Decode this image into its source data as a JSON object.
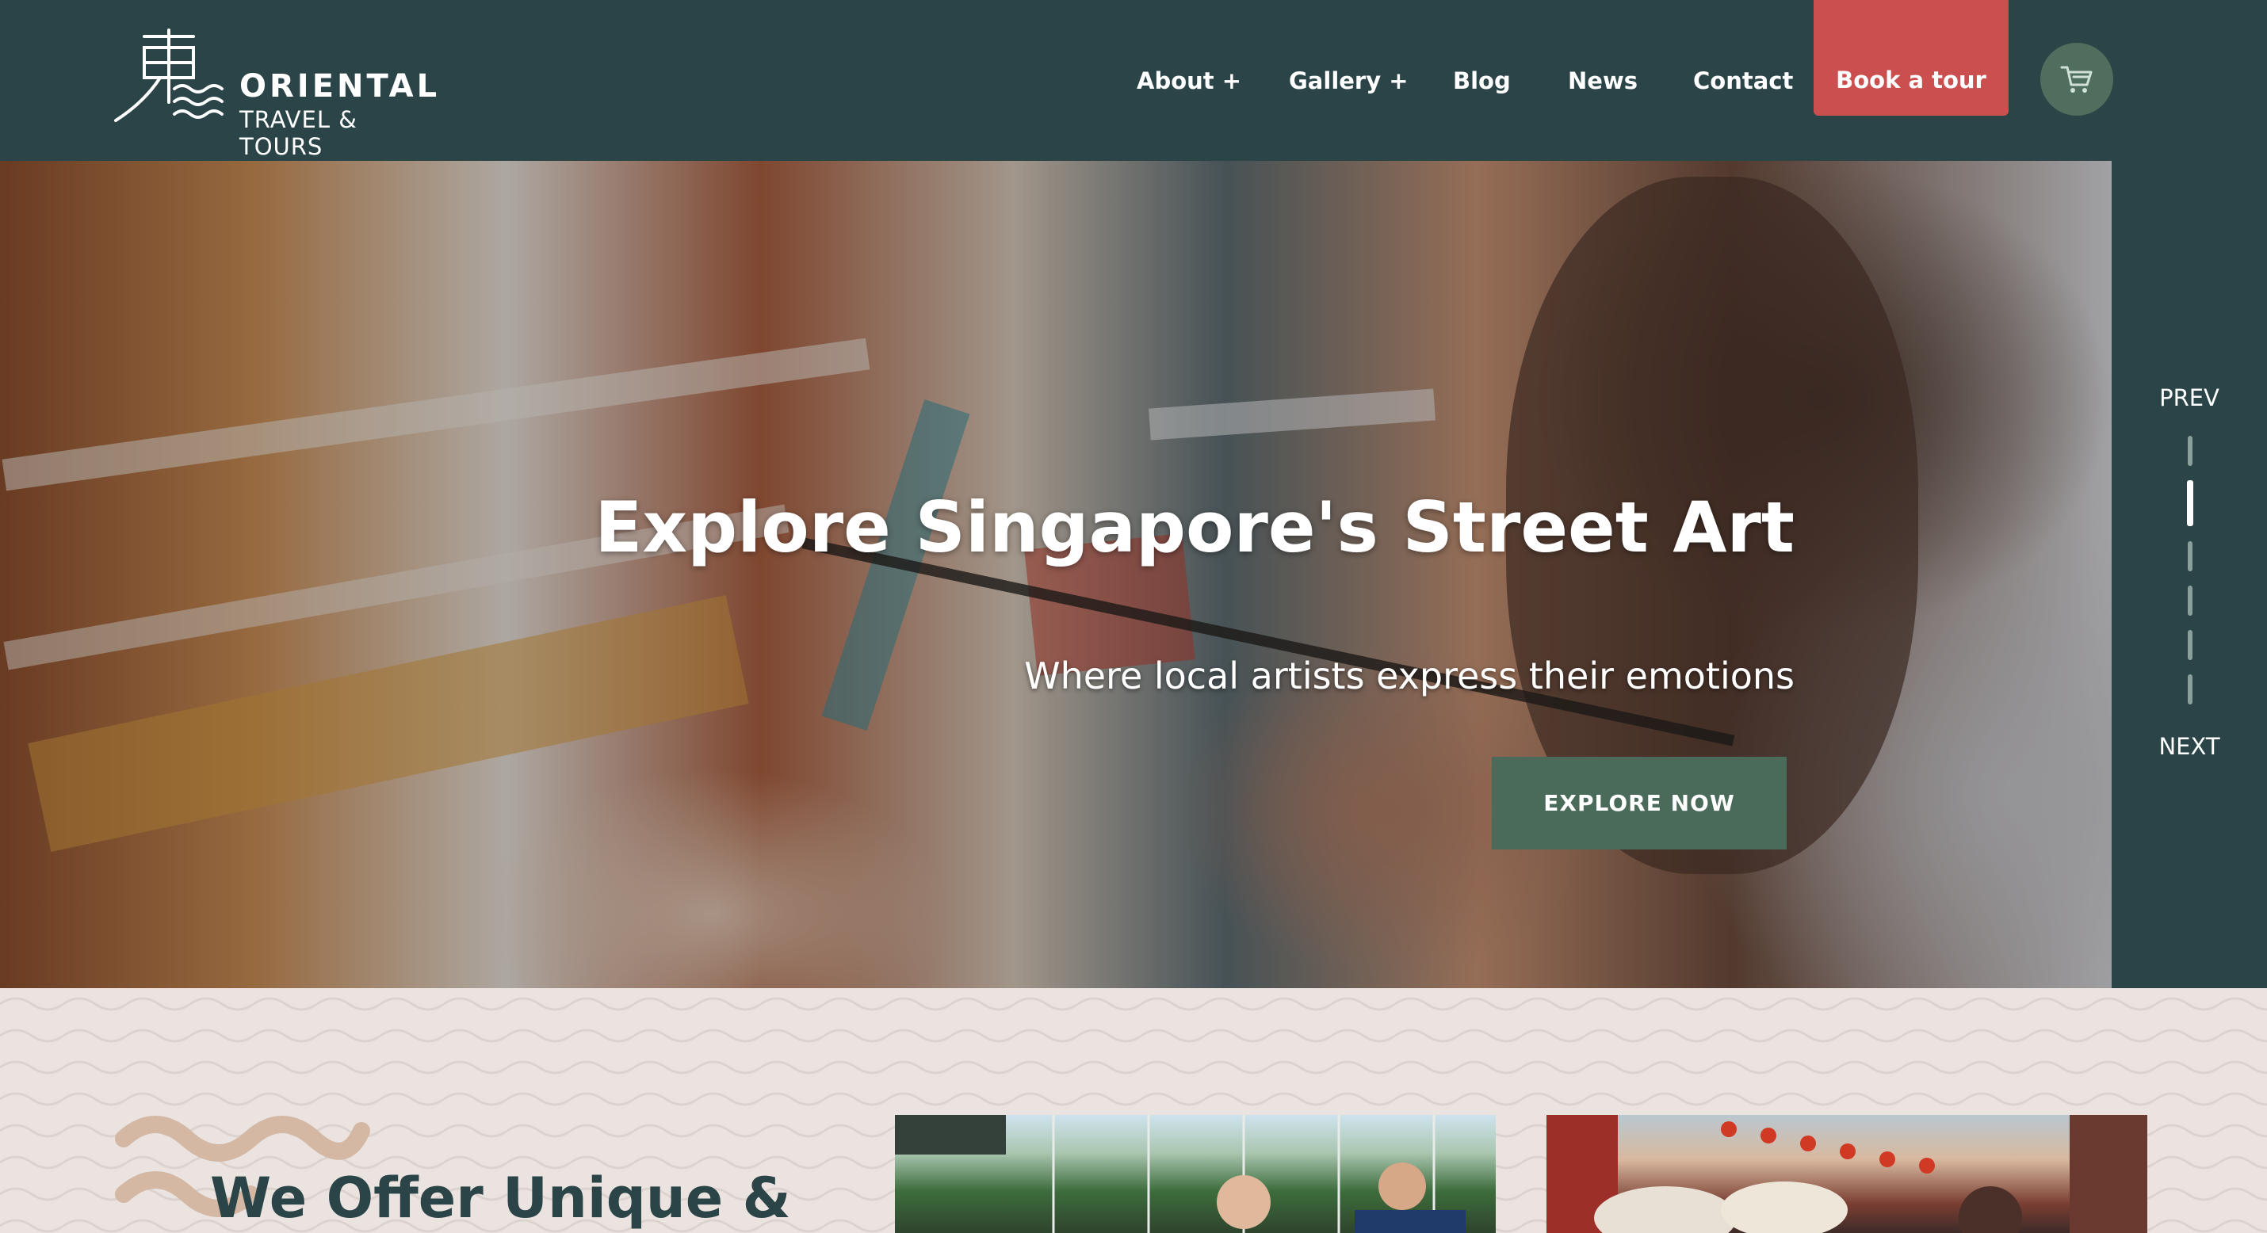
{
  "brand": {
    "name_top": "ORIENTAL",
    "name_bottom": "TRAVEL & TOURS"
  },
  "nav": {
    "items": [
      {
        "label": "About +"
      },
      {
        "label": "Gallery +"
      },
      {
        "label": "Blog"
      },
      {
        "label": "News"
      },
      {
        "label": "Contact"
      }
    ],
    "book_label": "Book a tour",
    "cart_icon": "cart-icon"
  },
  "hero": {
    "title": "Explore Singapore's Street Art",
    "subtitle": "Where local artists express their emotions",
    "cta_label": "EXPLORE NOW"
  },
  "slider": {
    "prev_label": "PREV",
    "next_label": "NEXT",
    "slide_count": 6,
    "active_index": 1
  },
  "section": {
    "title": "We Offer Unique &"
  },
  "colors": {
    "header_bg": "#2a4448",
    "book_button": "#cc4f4f",
    "explore_button": "#4a6a5a",
    "section_bg": "#ebe3df",
    "section_title": "#2a4448"
  }
}
